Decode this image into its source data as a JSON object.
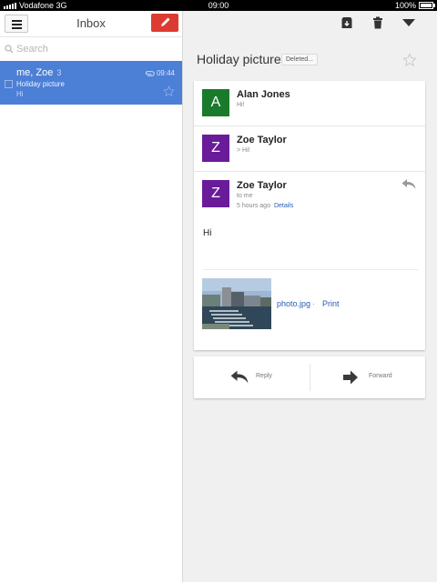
{
  "status_bar": {
    "carrier": "Vodafone 3G",
    "time": "09:00",
    "battery": "100%"
  },
  "inbox": {
    "title": "Inbox",
    "search_placeholder": "Search",
    "threads": [
      {
        "from": "me, Zoe",
        "count": "3",
        "time": "09:44",
        "subject": "Holiday picture",
        "snippet": "Hi"
      }
    ]
  },
  "conversation": {
    "subject": "Holiday picture",
    "label": "Deleted...",
    "messages": [
      {
        "sender": "Alan Jones",
        "initial": "A",
        "snippet": "Hi!",
        "avatar_color": "#197a2b"
      },
      {
        "sender": "Zoe Taylor",
        "initial": "Z",
        "snippet": "> Hi!",
        "avatar_color": "#6a1b9a"
      },
      {
        "sender": "Zoe Taylor",
        "initial": "Z",
        "to": "to me",
        "time": "5 hours ago",
        "details": "Details",
        "body": "Hi",
        "avatar_color": "#6a1b9a"
      }
    ],
    "attachment": {
      "filename": "photo.jpg",
      "separator": "·",
      "print": "Print"
    },
    "actions": {
      "reply": "Reply",
      "forward": "Forward"
    }
  },
  "icons": {
    "menu": "menu-icon",
    "compose": "pencil-icon",
    "search": "search-icon",
    "attachment": "paperclip-icon",
    "star": "star-icon",
    "archive": "archive-icon",
    "delete": "trash-icon",
    "more": "dropdown-icon",
    "reply": "reply-icon",
    "forward": "forward-icon"
  },
  "colors": {
    "accent_red": "#dd3b32",
    "selected_blue": "#4c7fd6",
    "link_blue": "#2a5db0"
  }
}
